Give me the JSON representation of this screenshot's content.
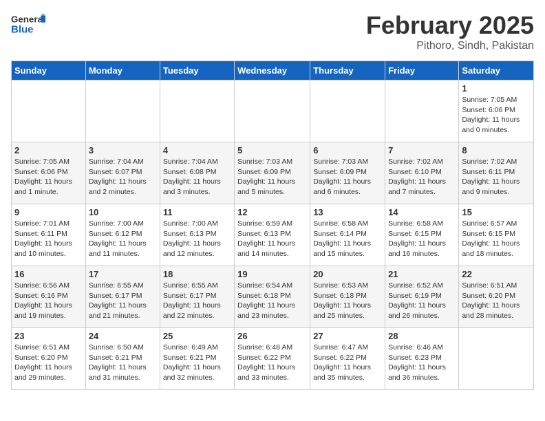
{
  "header": {
    "logo_general": "General",
    "logo_blue": "Blue",
    "month_title": "February 2025",
    "location": "Pithoro, Sindh, Pakistan"
  },
  "days_of_week": [
    "Sunday",
    "Monday",
    "Tuesday",
    "Wednesday",
    "Thursday",
    "Friday",
    "Saturday"
  ],
  "weeks": [
    [
      {
        "day": "",
        "info": ""
      },
      {
        "day": "",
        "info": ""
      },
      {
        "day": "",
        "info": ""
      },
      {
        "day": "",
        "info": ""
      },
      {
        "day": "",
        "info": ""
      },
      {
        "day": "",
        "info": ""
      },
      {
        "day": "1",
        "info": "Sunrise: 7:05 AM\nSunset: 6:06 PM\nDaylight: 11 hours\nand 0 minutes."
      }
    ],
    [
      {
        "day": "2",
        "info": "Sunrise: 7:05 AM\nSunset: 6:06 PM\nDaylight: 11 hours\nand 1 minute."
      },
      {
        "day": "3",
        "info": "Sunrise: 7:04 AM\nSunset: 6:07 PM\nDaylight: 11 hours\nand 2 minutes."
      },
      {
        "day": "4",
        "info": "Sunrise: 7:04 AM\nSunset: 6:08 PM\nDaylight: 11 hours\nand 3 minutes."
      },
      {
        "day": "5",
        "info": "Sunrise: 7:03 AM\nSunset: 6:09 PM\nDaylight: 11 hours\nand 5 minutes."
      },
      {
        "day": "6",
        "info": "Sunrise: 7:03 AM\nSunset: 6:09 PM\nDaylight: 11 hours\nand 6 minutes."
      },
      {
        "day": "7",
        "info": "Sunrise: 7:02 AM\nSunset: 6:10 PM\nDaylight: 11 hours\nand 7 minutes."
      },
      {
        "day": "8",
        "info": "Sunrise: 7:02 AM\nSunset: 6:11 PM\nDaylight: 11 hours\nand 9 minutes."
      }
    ],
    [
      {
        "day": "9",
        "info": "Sunrise: 7:01 AM\nSunset: 6:11 PM\nDaylight: 11 hours\nand 10 minutes."
      },
      {
        "day": "10",
        "info": "Sunrise: 7:00 AM\nSunset: 6:12 PM\nDaylight: 11 hours\nand 11 minutes."
      },
      {
        "day": "11",
        "info": "Sunrise: 7:00 AM\nSunset: 6:13 PM\nDaylight: 11 hours\nand 12 minutes."
      },
      {
        "day": "12",
        "info": "Sunrise: 6:59 AM\nSunset: 6:13 PM\nDaylight: 11 hours\nand 14 minutes."
      },
      {
        "day": "13",
        "info": "Sunrise: 6:58 AM\nSunset: 6:14 PM\nDaylight: 11 hours\nand 15 minutes."
      },
      {
        "day": "14",
        "info": "Sunrise: 6:58 AM\nSunset: 6:15 PM\nDaylight: 11 hours\nand 16 minutes."
      },
      {
        "day": "15",
        "info": "Sunrise: 6:57 AM\nSunset: 6:15 PM\nDaylight: 11 hours\nand 18 minutes."
      }
    ],
    [
      {
        "day": "16",
        "info": "Sunrise: 6:56 AM\nSunset: 6:16 PM\nDaylight: 11 hours\nand 19 minutes."
      },
      {
        "day": "17",
        "info": "Sunrise: 6:55 AM\nSunset: 6:17 PM\nDaylight: 11 hours\nand 21 minutes."
      },
      {
        "day": "18",
        "info": "Sunrise: 6:55 AM\nSunset: 6:17 PM\nDaylight: 11 hours\nand 22 minutes."
      },
      {
        "day": "19",
        "info": "Sunrise: 6:54 AM\nSunset: 6:18 PM\nDaylight: 11 hours\nand 23 minutes."
      },
      {
        "day": "20",
        "info": "Sunrise: 6:53 AM\nSunset: 6:18 PM\nDaylight: 11 hours\nand 25 minutes."
      },
      {
        "day": "21",
        "info": "Sunrise: 6:52 AM\nSunset: 6:19 PM\nDaylight: 11 hours\nand 26 minutes."
      },
      {
        "day": "22",
        "info": "Sunrise: 6:51 AM\nSunset: 6:20 PM\nDaylight: 11 hours\nand 28 minutes."
      }
    ],
    [
      {
        "day": "23",
        "info": "Sunrise: 6:51 AM\nSunset: 6:20 PM\nDaylight: 11 hours\nand 29 minutes."
      },
      {
        "day": "24",
        "info": "Sunrise: 6:50 AM\nSunset: 6:21 PM\nDaylight: 11 hours\nand 31 minutes."
      },
      {
        "day": "25",
        "info": "Sunrise: 6:49 AM\nSunset: 6:21 PM\nDaylight: 11 hours\nand 32 minutes."
      },
      {
        "day": "26",
        "info": "Sunrise: 6:48 AM\nSunset: 6:22 PM\nDaylight: 11 hours\nand 33 minutes."
      },
      {
        "day": "27",
        "info": "Sunrise: 6:47 AM\nSunset: 6:22 PM\nDaylight: 11 hours\nand 35 minutes."
      },
      {
        "day": "28",
        "info": "Sunrise: 6:46 AM\nSunset: 6:23 PM\nDaylight: 11 hours\nand 36 minutes."
      },
      {
        "day": "",
        "info": ""
      }
    ]
  ]
}
